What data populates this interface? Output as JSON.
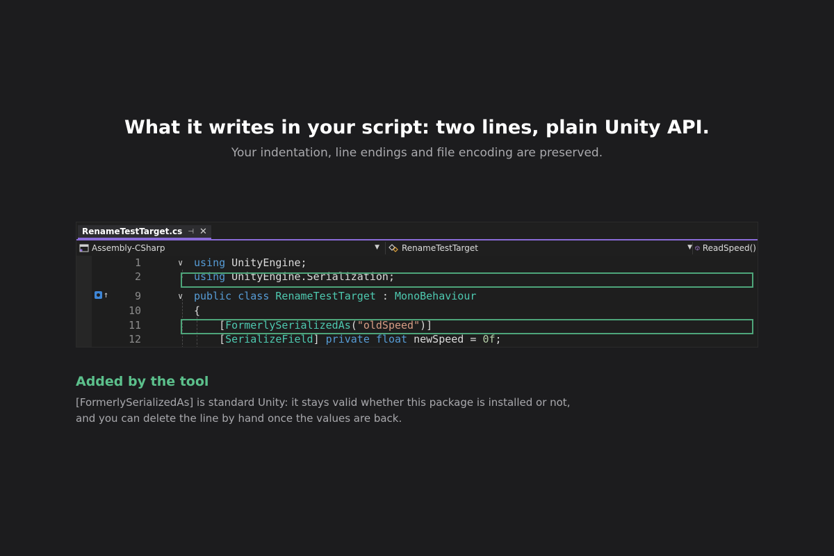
{
  "heading": {
    "title": "What it writes in your script: two lines, plain Unity API.",
    "subtitle": "Your indentation, line endings and file encoding are preserved."
  },
  "ide": {
    "tab": {
      "label": "RenameTestTarget.cs",
      "pin_icon": "pin-icon",
      "close_icon": "close-icon"
    },
    "navbar": {
      "project": "Assembly-CSharp",
      "type": "RenameTestTarget",
      "member": "ReadSpeed()"
    },
    "lines": [
      {
        "number": "1",
        "tokens": [
          {
            "t": "using",
            "c": "kw"
          },
          {
            "t": " UnityEngine;",
            "c": "plain"
          }
        ]
      },
      {
        "number": "2",
        "tokens": [
          {
            "t": "using",
            "c": "kw"
          },
          {
            "t": " UnityEngine.Serialization;",
            "c": "plain"
          }
        ]
      },
      {
        "number": "9",
        "tokens": [
          {
            "t": "public",
            "c": "kw"
          },
          {
            "t": " ",
            "c": "plain"
          },
          {
            "t": "class",
            "c": "kw"
          },
          {
            "t": " ",
            "c": "plain"
          },
          {
            "t": "RenameTestTarget",
            "c": "ty"
          },
          {
            "t": " : ",
            "c": "plain"
          },
          {
            "t": "MonoBehaviour",
            "c": "ty"
          }
        ]
      },
      {
        "number": "10",
        "tokens": [
          {
            "t": "{",
            "c": "plain"
          }
        ]
      },
      {
        "number": "11",
        "tokens": [
          {
            "t": "    [",
            "c": "plain"
          },
          {
            "t": "FormerlySerializedAs",
            "c": "ty"
          },
          {
            "t": "(",
            "c": "plain"
          },
          {
            "t": "\"oldSpeed\"",
            "c": "st"
          },
          {
            "t": ")]",
            "c": "plain"
          }
        ]
      },
      {
        "number": "12",
        "tokens": [
          {
            "t": "    [",
            "c": "plain"
          },
          {
            "t": "SerializeField",
            "c": "ty"
          },
          {
            "t": "] ",
            "c": "plain"
          },
          {
            "t": "private",
            "c": "kw"
          },
          {
            "t": " ",
            "c": "plain"
          },
          {
            "t": "float",
            "c": "kw"
          },
          {
            "t": " newSpeed = ",
            "c": "plain"
          },
          {
            "t": "0f",
            "c": "nu"
          },
          {
            "t": ";",
            "c": "plain"
          }
        ]
      }
    ],
    "highlight_color": "#4ea57a"
  },
  "added": {
    "title": "Added by the tool",
    "body_line1": "[FormerlySerializedAs] is standard Unity: it stays valid whether this package is installed or not,",
    "body_line2": "and you can delete the line by hand once the values are back."
  }
}
